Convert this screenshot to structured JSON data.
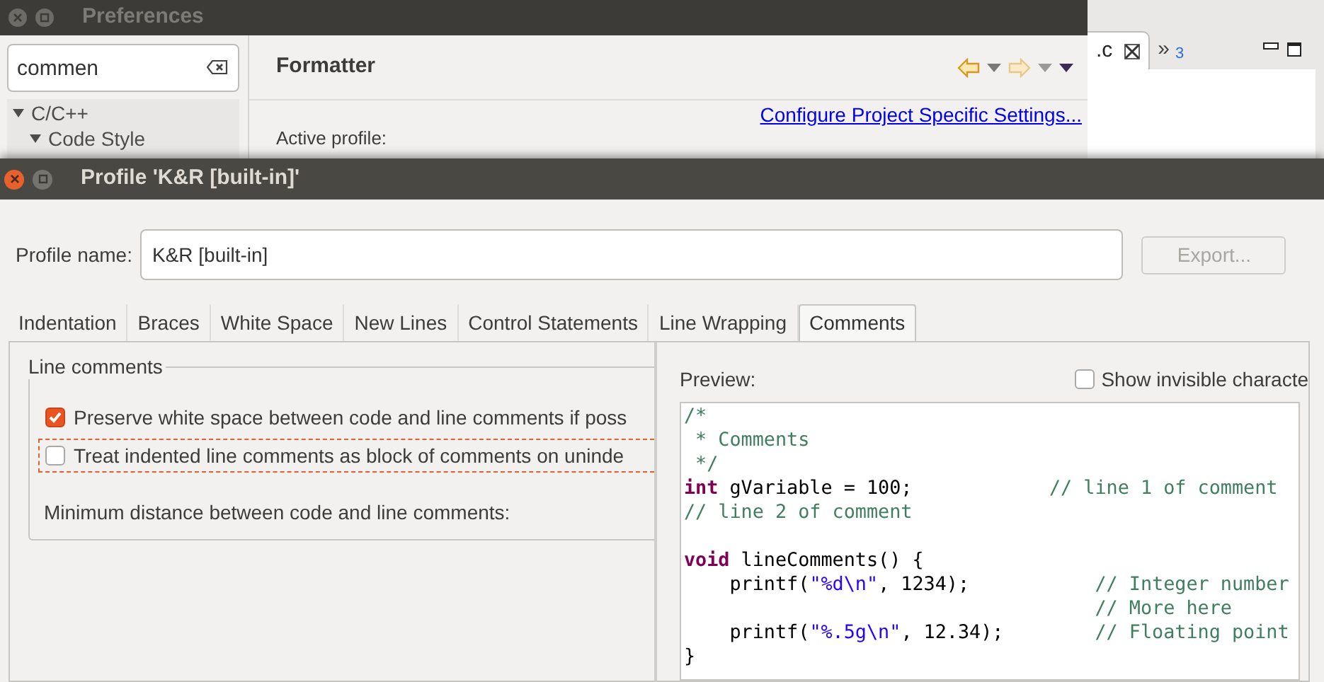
{
  "preferences_window": {
    "title": "Preferences",
    "search": {
      "value": "commen"
    },
    "tree": [
      {
        "label": "C/C++",
        "expanded": true,
        "children": [
          {
            "label": "Code Style",
            "expanded": true
          }
        ]
      }
    ],
    "page_title": "Formatter",
    "link": "Configure Project Specific Settings...",
    "active_profile_label": "Active profile:"
  },
  "editor": {
    "tabs": [
      {
        "label": ".c",
        "selected": true
      },
      {
        "label": "»",
        "count": "3",
        "selected": false
      }
    ]
  },
  "dialog": {
    "title": "Profile 'K&R [built-in]'",
    "profile_name_label": "Profile name:",
    "profile_name": "K&R [built-in]",
    "export_button": {
      "label": "Export...",
      "disabled": true
    },
    "tabs": [
      {
        "label": "Indentation",
        "selected": false
      },
      {
        "label": "Braces",
        "selected": false
      },
      {
        "label": "White Space",
        "selected": false
      },
      {
        "label": "New Lines",
        "selected": false
      },
      {
        "label": "Control Statements",
        "selected": false
      },
      {
        "label": "Line Wrapping",
        "selected": false
      },
      {
        "label": "Comments",
        "selected": true
      }
    ],
    "group_title": "Line comments",
    "options": [
      {
        "label": "Preserve white space between code and line comments if poss",
        "checked": true,
        "focused": false
      },
      {
        "label": "Treat indented line comments as block of comments on uninde",
        "checked": false,
        "focused": true
      }
    ],
    "min_distance_label": "Minimum distance between code and line comments:",
    "preview_label": "Preview:",
    "show_invisible": {
      "label": "Show invisible characte",
      "checked": false
    },
    "code_lines": [
      {
        "kind": "code",
        "tokens": [
          {
            "kind": "comment",
            "text": "/*"
          }
        ]
      },
      {
        "kind": "code",
        "tokens": [
          {
            "kind": "comment",
            "text": " * Comments"
          }
        ]
      },
      {
        "kind": "code",
        "tokens": [
          {
            "kind": "comment",
            "text": " */"
          }
        ]
      },
      {
        "kind": "code",
        "tokens": [
          {
            "kind": "keyword",
            "text": "int"
          },
          {
            "kind": "plain",
            "text": " gVariable = 100;            "
          },
          {
            "kind": "comment",
            "text": "// line 1 of comment"
          }
        ]
      },
      {
        "kind": "code",
        "tokens": [
          {
            "kind": "comment",
            "text": "// line 2 of comment"
          }
        ]
      },
      {
        "kind": "blank"
      },
      {
        "kind": "code",
        "tokens": [
          {
            "kind": "keyword",
            "text": "void"
          },
          {
            "kind": "plain",
            "text": " lineComments() {"
          }
        ]
      },
      {
        "kind": "code",
        "tokens": [
          {
            "kind": "plain",
            "text": "    printf("
          },
          {
            "kind": "string",
            "text": "\"%d\\n\""
          },
          {
            "kind": "plain",
            "text": ", 1234);           "
          },
          {
            "kind": "comment",
            "text": "// Integer number"
          }
        ]
      },
      {
        "kind": "code",
        "tokens": [
          {
            "kind": "comment",
            "text": "                                    // More here"
          }
        ]
      },
      {
        "kind": "code",
        "tokens": [
          {
            "kind": "plain",
            "text": "    printf("
          },
          {
            "kind": "string",
            "text": "\"%.5g\\n\""
          },
          {
            "kind": "plain",
            "text": ", 12.34);        "
          },
          {
            "kind": "comment",
            "text": "// Floating point"
          }
        ]
      },
      {
        "kind": "code",
        "tokens": [
          {
            "kind": "plain",
            "text": "}"
          }
        ]
      }
    ]
  }
}
